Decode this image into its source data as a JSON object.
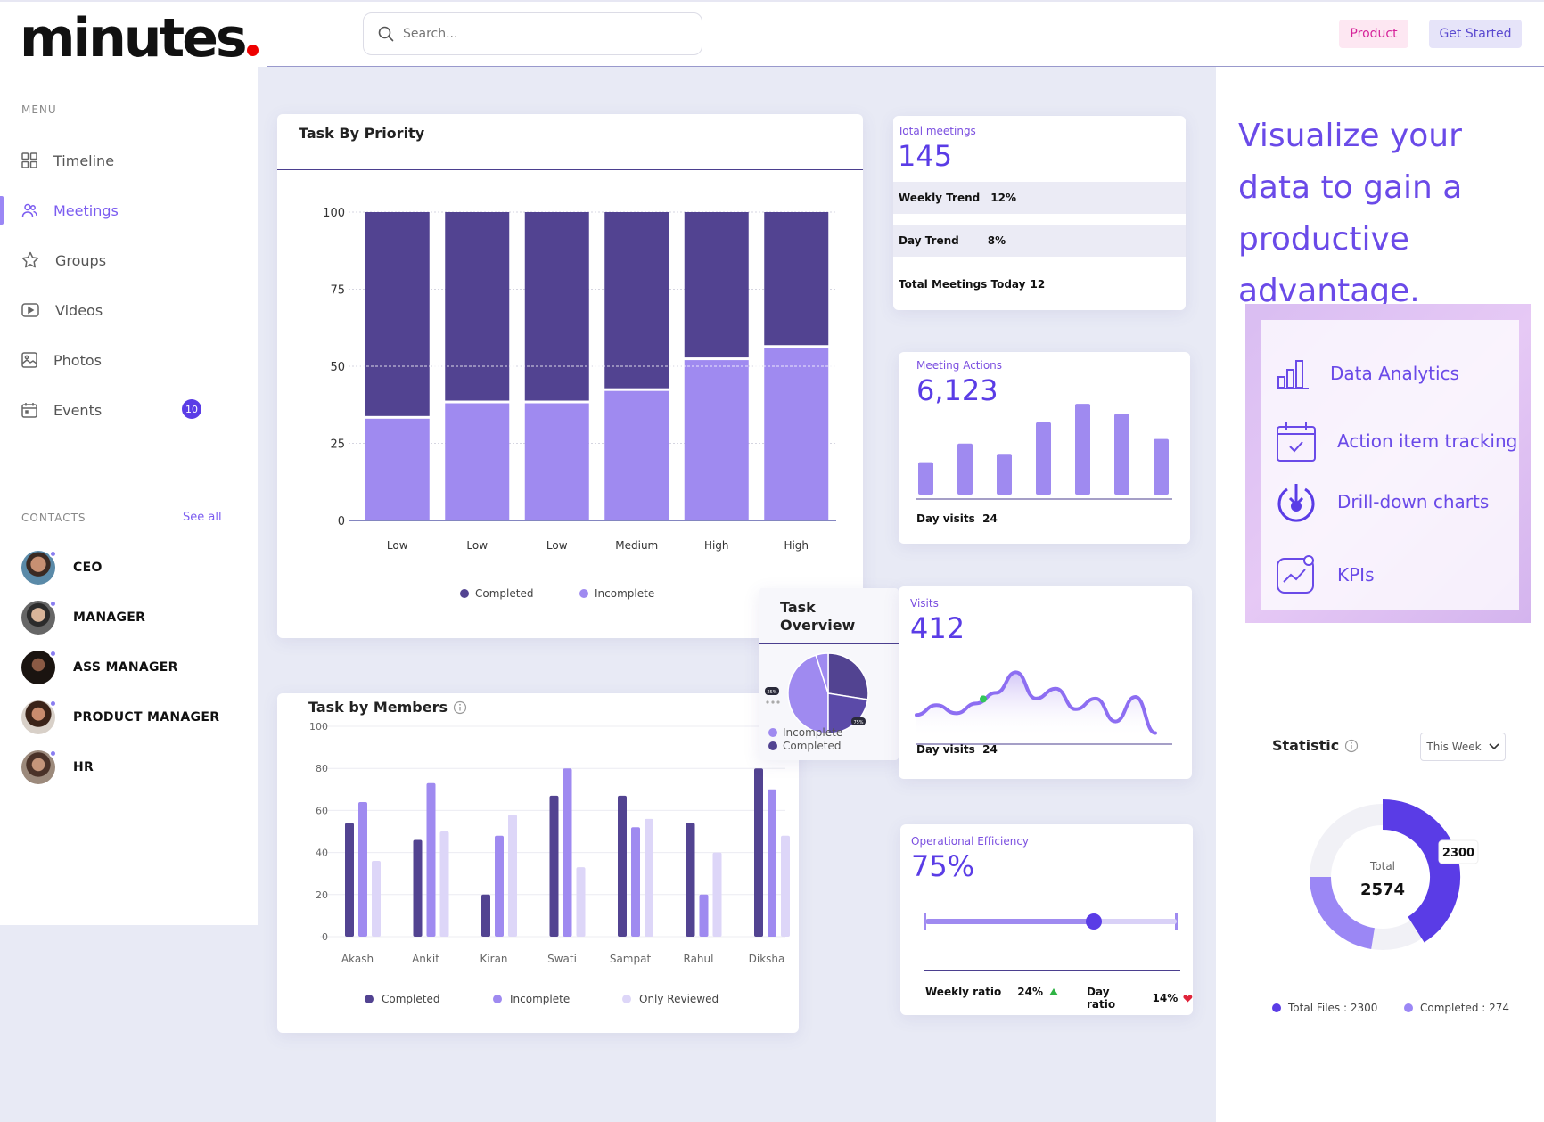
{
  "app": {
    "logo": "minutes"
  },
  "search": {
    "placeholder": "Search..."
  },
  "header": {
    "product_label": "Product",
    "get_started_label": "Get Started"
  },
  "sidebar": {
    "menu_label": "MENU",
    "items": [
      {
        "label": "Timeline",
        "icon": "grid-icon"
      },
      {
        "label": "Meetings",
        "icon": "users-icon",
        "active": true
      },
      {
        "label": "Groups",
        "icon": "star-icon"
      },
      {
        "label": "Videos",
        "icon": "video-icon"
      },
      {
        "label": "Photos",
        "icon": "photo-icon"
      },
      {
        "label": "Events",
        "icon": "calendar-icon",
        "badge": "10"
      }
    ],
    "contacts_label": "CONTACTS",
    "see_all": "See all",
    "contacts": [
      {
        "name": "CEO"
      },
      {
        "name": "MANAGER"
      },
      {
        "name": "ASS MANAGER"
      },
      {
        "name": "PRODUCT MANAGER"
      },
      {
        "name": "HR"
      }
    ]
  },
  "priority_card": {
    "title": "Task By Priority"
  },
  "members_card": {
    "title": "Task by Members"
  },
  "overview_card": {
    "title_line1": "Task",
    "title_line2": "Overview",
    "badge_small": "25%",
    "badge_large": "75%",
    "legend": [
      "Incomplete",
      "Completed"
    ]
  },
  "total_card": {
    "label": "Total meetings",
    "value": "145",
    "rows": [
      {
        "label": "Weekly Trend",
        "value": "12%"
      },
      {
        "label": "Day Trend",
        "value": "8%"
      },
      {
        "label": "Total Meetings Today",
        "value": "12"
      }
    ]
  },
  "actions_card": {
    "label": "Meeting Actions",
    "value": "6,123",
    "footer_label": "Day visits",
    "footer_value": "24",
    "bars": [
      0.35,
      0.55,
      0.44,
      0.78,
      0.98,
      0.87,
      0.6
    ]
  },
  "visits_card": {
    "label": "Visits",
    "value": "412",
    "footer_label": "Day visits",
    "footer_value": "24"
  },
  "efficiency_card": {
    "label": "Operational Efficiency",
    "value": "75%",
    "slider_fraction": 0.67,
    "weekly_label": "Weekly ratio",
    "weekly_value": "24%",
    "day_label": "Day ratio",
    "day_value": "14%"
  },
  "right_panel": {
    "headline": "Visualize your  data to gain a productive advantage.",
    "features": [
      {
        "label": "Data Analytics",
        "icon": "bar-chart-icon"
      },
      {
        "label": "Action item tracking",
        "icon": "calendar-check-icon"
      },
      {
        "label": "Drill-down charts",
        "icon": "drill-down-icon"
      },
      {
        "label": "KPIs",
        "icon": "trend-line-icon"
      }
    ],
    "statistic_title": "Statistic",
    "period": "This Week",
    "donut": {
      "total_label": "Total",
      "total_value": "2574",
      "callout": "2300"
    },
    "legend": [
      {
        "label": "Total Files : 2300",
        "color": "#5a3ce6"
      },
      {
        "label": "Completed  : 274",
        "color": "#9b87f5"
      }
    ]
  },
  "colors": {
    "completed": "#524391",
    "incomplete": "#9f8af0",
    "only_reviewed": "#ddd6f8",
    "accent": "#5a3ce6"
  },
  "chart_data": [
    {
      "type": "bar",
      "stacked": true,
      "title": "Task By Priority",
      "categories": [
        "Low",
        "Low",
        "Low",
        "Medium",
        "High",
        "High"
      ],
      "series": [
        {
          "name": "Completed",
          "values": [
            67,
            62,
            62,
            58,
            48,
            44
          ]
        },
        {
          "name": "Incomplete",
          "values": [
            33,
            38,
            38,
            42,
            52,
            56
          ]
        }
      ],
      "ylim": [
        0,
        100
      ],
      "yticks": [
        0,
        25,
        50,
        75,
        100
      ],
      "legend": "bottom"
    },
    {
      "type": "bar",
      "title": "Task by Members",
      "categories": [
        "Akash",
        "Ankit",
        "Kiran",
        "Swati",
        "Sampat",
        "Rahul",
        "Diksha"
      ],
      "series": [
        {
          "name": "Completed",
          "values": [
            54,
            46,
            20,
            67,
            67,
            54,
            80
          ]
        },
        {
          "name": "Incomplete",
          "values": [
            64,
            73,
            48,
            80,
            52,
            20,
            70
          ]
        },
        {
          "name": "Only Reviewed",
          "values": [
            36,
            50,
            58,
            33,
            56,
            40,
            48
          ]
        }
      ],
      "ylim": [
        0,
        100
      ],
      "yticks": [
        0,
        20,
        40,
        60,
        80,
        100
      ],
      "legend": "bottom"
    },
    {
      "type": "pie",
      "title": "Task Overview",
      "series": [
        {
          "name": "Incomplete",
          "values": [
            25
          ]
        },
        {
          "name": "Completed",
          "values": [
            75
          ]
        }
      ]
    },
    {
      "type": "line",
      "title": "Visits",
      "x": [
        0,
        1,
        2,
        3,
        4,
        5,
        6,
        7,
        8,
        9,
        10,
        11,
        12
      ],
      "values": [
        28,
        40,
        30,
        42,
        55,
        80,
        48,
        60,
        35,
        48,
        20,
        50,
        6
      ]
    },
    {
      "type": "pie",
      "title": "Statistic",
      "series": [
        {
          "name": "Total Files",
          "values": [
            2300
          ]
        },
        {
          "name": "Completed",
          "values": [
            274
          ]
        }
      ]
    }
  ]
}
